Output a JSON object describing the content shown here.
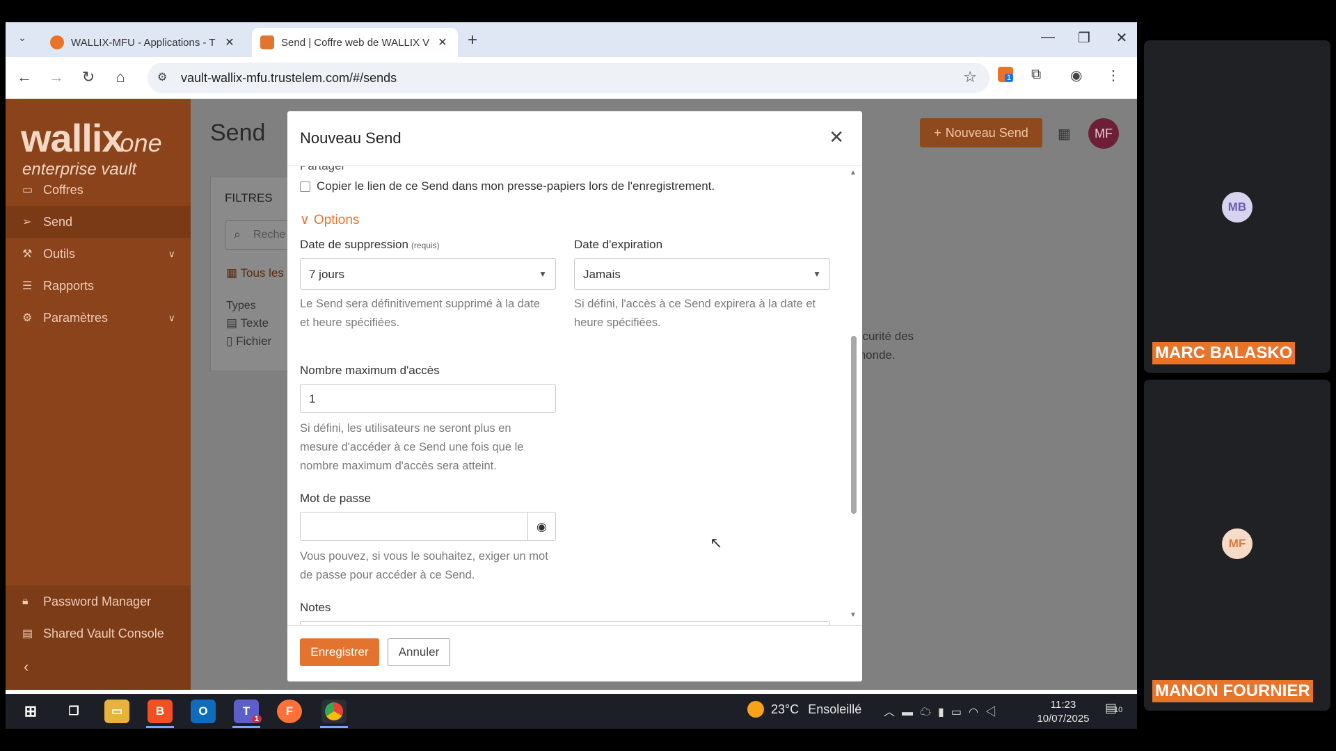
{
  "browser": {
    "tabs": [
      {
        "title": "WALLIX-MFU - Applications - T",
        "active": false
      },
      {
        "title": "Send | Coffre web de WALLIX V",
        "active": true
      }
    ],
    "url": "vault-wallix-mfu.trustelem.com/#/sends"
  },
  "app": {
    "logo_main": "wallix",
    "logo_suffix": "one",
    "logo_sub": "enterprise vault",
    "nav": [
      {
        "label": "Coffres",
        "icon": "vault-icon"
      },
      {
        "label": "Send",
        "icon": "send-icon"
      },
      {
        "label": "Outils",
        "icon": "tools-icon"
      },
      {
        "label": "Rapports",
        "icon": "reports-icon"
      },
      {
        "label": "Paramètres",
        "icon": "settings-icon"
      }
    ],
    "nav_bottom": [
      {
        "label": "Password Manager",
        "icon": "lock-icon"
      },
      {
        "label": "Shared Vault Console",
        "icon": "console-icon"
      }
    ],
    "page_title": "Send",
    "filters": {
      "header": "FILTRES",
      "search_placeholder": "Reche",
      "all_label": "Tous les",
      "types_label": "Types",
      "type_text": "Texte",
      "type_file": "Fichier"
    },
    "bg_text_line1": "écurité des",
    "bg_text_line2": "monde.",
    "new_send_label": "Nouveau Send",
    "avatar_initials": "MF"
  },
  "modal": {
    "title": "Nouveau Send",
    "partial_heading": "Partager",
    "copy_link_label": "Copier le lien de ce Send dans mon presse-papiers lors de l'enregistrement.",
    "options_label": "Options",
    "deletion_date": {
      "label": "Date de suppression",
      "required": "(requis)",
      "value": "7 jours",
      "hint": "Le Send sera définitivement supprimé à la date et heure spécifiées."
    },
    "expiration_date": {
      "label": "Date d'expiration",
      "value": "Jamais",
      "hint": "Si défini, l'accès à ce Send expirera à la date et heure spécifiées."
    },
    "max_access": {
      "label": "Nombre maximum d'accès",
      "value": "1",
      "hint": "Si défini, les utilisateurs ne seront plus en mesure d'accéder à ce Send une fois que le nombre maximum d'accès sera atteint."
    },
    "password": {
      "label": "Mot de passe",
      "value": "",
      "hint": "Vous pouvez, si vous le souhaitez, exiger un mot de passe pour accéder à ce Send."
    },
    "notes_label": "Notes",
    "save_label": "Enregistrer",
    "cancel_label": "Annuler"
  },
  "taskbar": {
    "weather_temp": "23°C",
    "weather_desc": "Ensoleillé",
    "time": "11:23",
    "date": "10/07/2025",
    "notif_count": "10",
    "teams_badge": "1",
    "ext_badge": "1"
  },
  "participants": [
    {
      "initials": "MB",
      "name": "MARC BALASKO"
    },
    {
      "initials": "MF",
      "name": "MANON FOURNIER"
    }
  ],
  "colors": {
    "brand": "#e3742f",
    "sidebar": "#8a431a",
    "name_tag": "#e8742a"
  }
}
